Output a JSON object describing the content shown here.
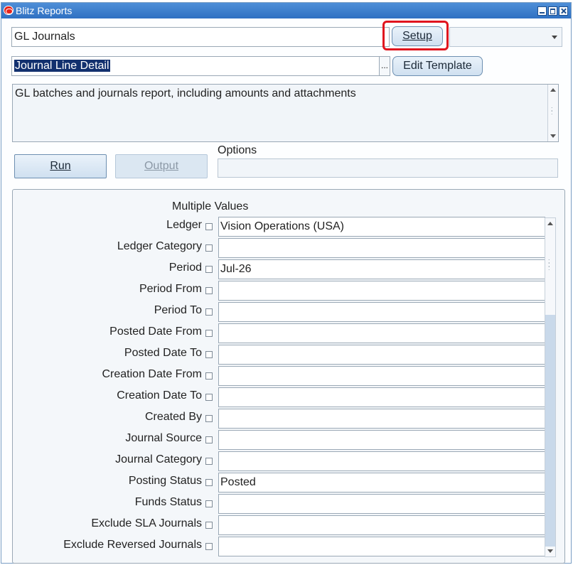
{
  "window": {
    "title": "Blitz Reports"
  },
  "report": {
    "name": "GL Journals",
    "setup_label": "Setup",
    "template_value": "Journal Line Detail",
    "lov_label": "...",
    "edit_template_label": "Edit Template",
    "description": "GL batches and journals report, including amounts and attachments"
  },
  "actions": {
    "run_label": "Run",
    "output_label": "Output",
    "options_label": "Options",
    "options_value": ""
  },
  "parameters": {
    "header": "Multiple Values",
    "rows": [
      {
        "label": "Ledger",
        "value": "Vision Operations (USA)"
      },
      {
        "label": "Ledger Category",
        "value": ""
      },
      {
        "label": "Period",
        "value": "Jul-26"
      },
      {
        "label": "Period From",
        "value": ""
      },
      {
        "label": "Period To",
        "value": ""
      },
      {
        "label": "Posted Date From",
        "value": ""
      },
      {
        "label": "Posted Date To",
        "value": ""
      },
      {
        "label": "Creation Date From",
        "value": ""
      },
      {
        "label": "Creation Date To",
        "value": ""
      },
      {
        "label": "Created By",
        "value": ""
      },
      {
        "label": "Journal Source",
        "value": ""
      },
      {
        "label": "Journal Category",
        "value": ""
      },
      {
        "label": "Posting Status",
        "value": "Posted"
      },
      {
        "label": "Funds Status",
        "value": ""
      },
      {
        "label": "Exclude SLA Journals",
        "value": ""
      },
      {
        "label": "Exclude Reversed Journals",
        "value": ""
      }
    ]
  },
  "colors": {
    "titlebar": "#2f70c2",
    "highlight": "#e0141e",
    "selection": "#12306e"
  }
}
